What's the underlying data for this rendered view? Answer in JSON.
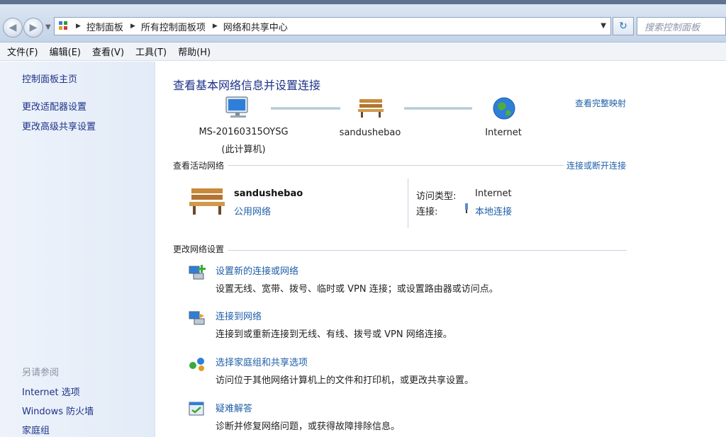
{
  "address": {
    "crumbs": [
      "控制面板",
      "所有控制面板项",
      "网络和共享中心"
    ],
    "search_placeholder": "搜索控制面板"
  },
  "menu": [
    "文件(F)",
    "编辑(E)",
    "查看(V)",
    "工具(T)",
    "帮助(H)"
  ],
  "sidebar": {
    "links": [
      "控制面板主页",
      "更改适配器设置",
      "更改高级共享设置"
    ],
    "see_also_heading": "另请参阅",
    "see_also": [
      "Internet 选项",
      "Windows 防火墙",
      "家庭组"
    ]
  },
  "main": {
    "title": "查看基本网络信息并设置连接",
    "view_full_map": "查看完整映射",
    "map": {
      "computer_name": "MS-20160315OYSG",
      "computer_sub": "(此计算机)",
      "network_name": "sandushebao",
      "internet_label": "Internet"
    },
    "active_section_label": "查看活动网络",
    "connect_disconnect": "连接或断开连接",
    "active": {
      "name": "sandushebao",
      "type": "公用网络",
      "access_key": "访问类型:",
      "access_val": "Internet",
      "conn_key": "连接:",
      "conn_val": "本地连接"
    },
    "change_section_label": "更改网络设置",
    "tasks": [
      {
        "title": "设置新的连接或网络",
        "desc": "设置无线、宽带、拨号、临时或 VPN 连接；或设置路由器或访问点。"
      },
      {
        "title": "连接到网络",
        "desc": "连接到或重新连接到无线、有线、拨号或 VPN 网络连接。"
      },
      {
        "title": "选择家庭组和共享选项",
        "desc": "访问位于其他网络计算机上的文件和打印机，或更改共享设置。"
      },
      {
        "title": "疑难解答",
        "desc": "诊断并修复网络问题，或获得故障排除信息。"
      }
    ]
  }
}
